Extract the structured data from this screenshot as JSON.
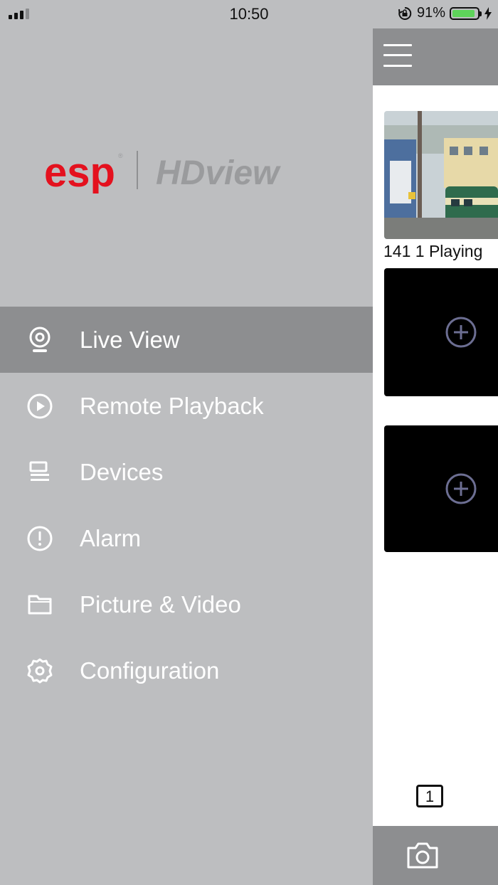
{
  "status_bar": {
    "time": "10:50",
    "battery_percent": "91%",
    "battery_level": 0.91,
    "signal_bars": 3,
    "icons": [
      "signal-icon",
      "orientation-lock-icon",
      "battery-icon",
      "charging-icon"
    ]
  },
  "drawer": {
    "logo": {
      "brand": "esp",
      "product": "HDview",
      "brand_color": "#e4111e",
      "product_color": "#9a9b9d"
    },
    "menu": [
      {
        "label": "Live View",
        "icon": "live-view-icon",
        "active": true
      },
      {
        "label": "Remote Playback",
        "icon": "playback-icon",
        "active": false
      },
      {
        "label": "Devices",
        "icon": "devices-icon",
        "active": false
      },
      {
        "label": "Alarm",
        "icon": "alarm-icon",
        "active": false
      },
      {
        "label": "Picture & Video",
        "icon": "folder-icon",
        "active": false
      },
      {
        "label": "Configuration",
        "icon": "gear-icon",
        "active": false
      }
    ]
  },
  "live_view": {
    "tiles": [
      {
        "label": "141 1 Playing",
        "state": "playing"
      },
      {
        "state": "empty",
        "icon": "add-channel-icon"
      },
      {
        "state": "empty",
        "icon": "add-channel-icon"
      }
    ],
    "page_indicator": "1"
  },
  "colors": {
    "drawer_bg": "#bdbec0",
    "active_item_bg": "#8d8e90",
    "bar_bg": "#8d8e90",
    "accent_green": "#5ed35a"
  }
}
